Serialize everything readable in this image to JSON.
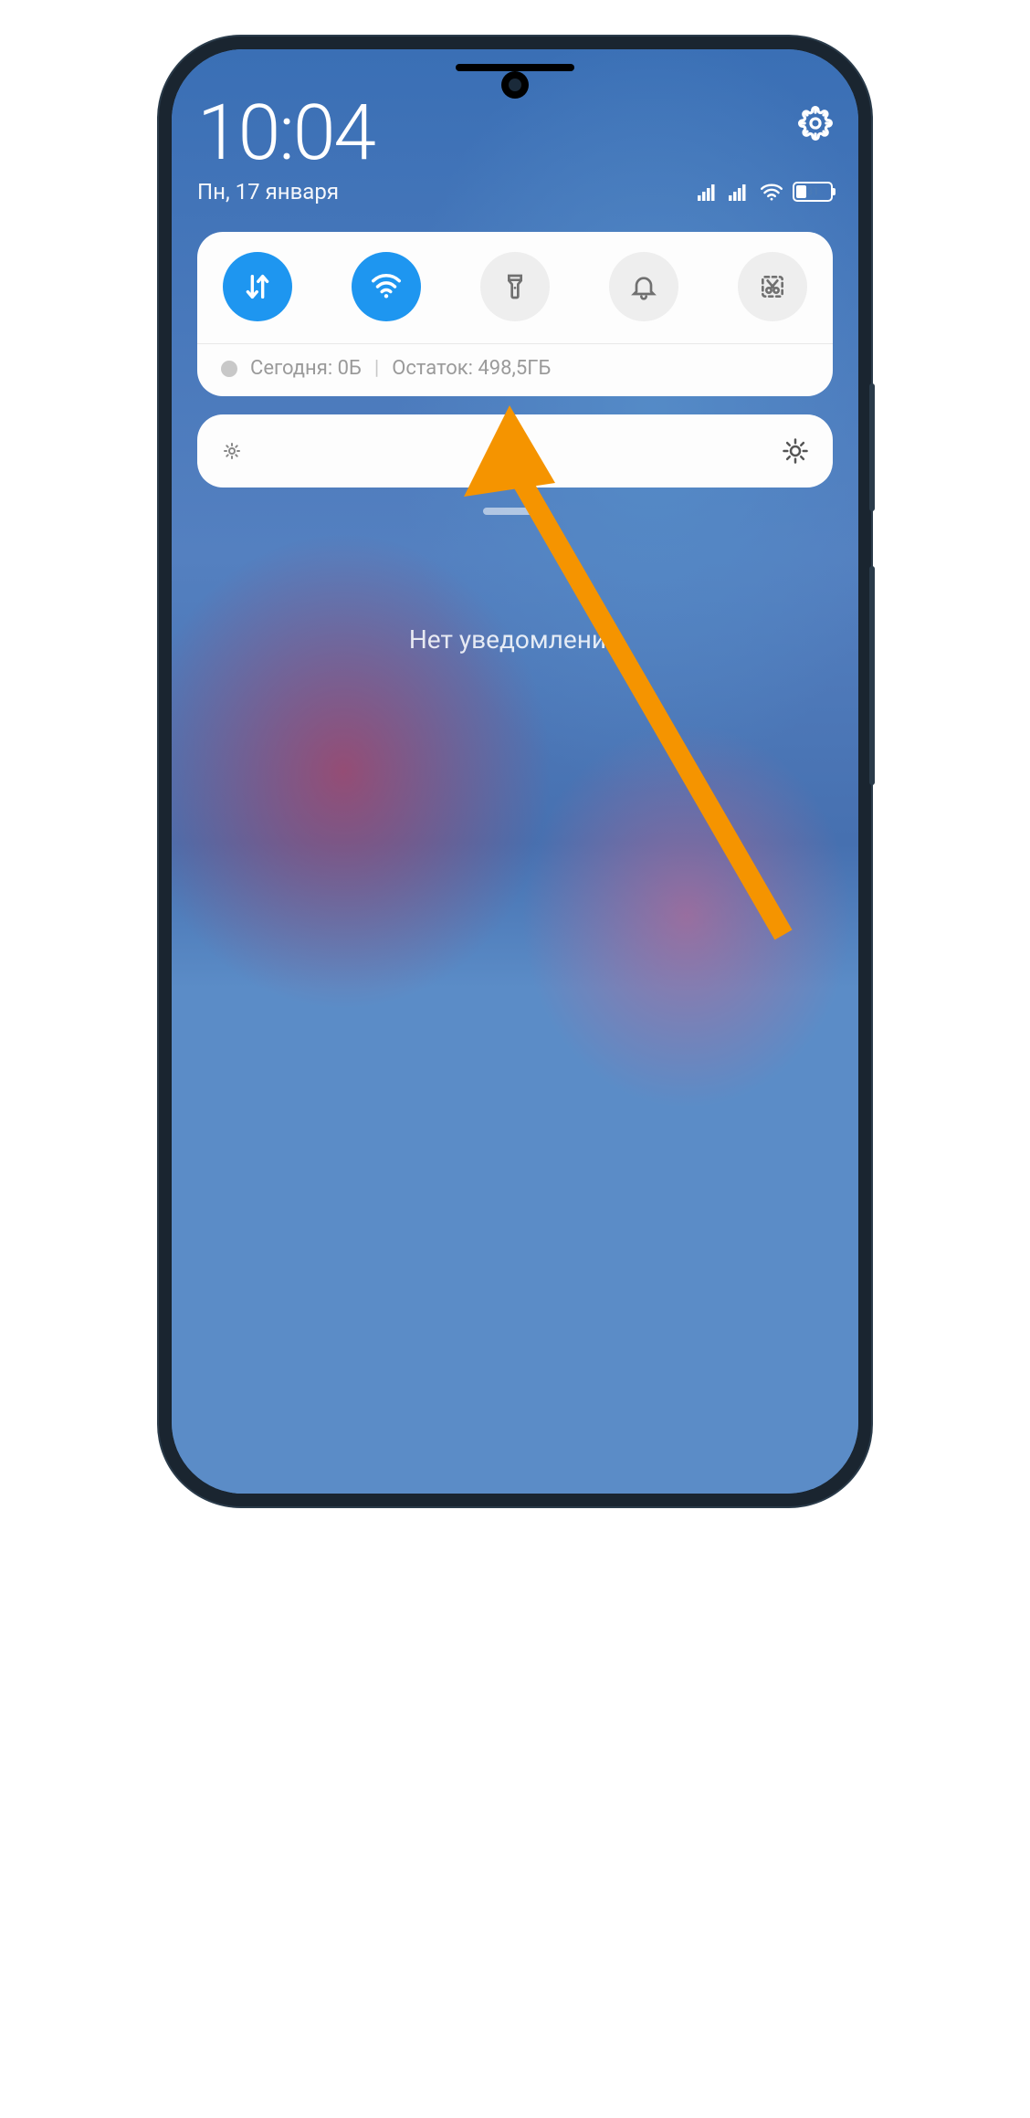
{
  "header": {
    "time": "10:04",
    "date": "Пн, 17 января"
  },
  "status": {
    "battery_percent": 31
  },
  "quick_settings": {
    "toggles": [
      {
        "name": "mobile-data",
        "active": true
      },
      {
        "name": "wifi",
        "active": true
      },
      {
        "name": "flashlight",
        "active": false
      },
      {
        "name": "do-not-disturb",
        "active": false
      },
      {
        "name": "screenshot",
        "active": false
      }
    ],
    "data_usage": {
      "today_label": "Сегодня: 0Б",
      "remaining_label": "Остаток: 498,5ГБ"
    }
  },
  "notifications": {
    "empty_text": "Нет уведомлений"
  }
}
